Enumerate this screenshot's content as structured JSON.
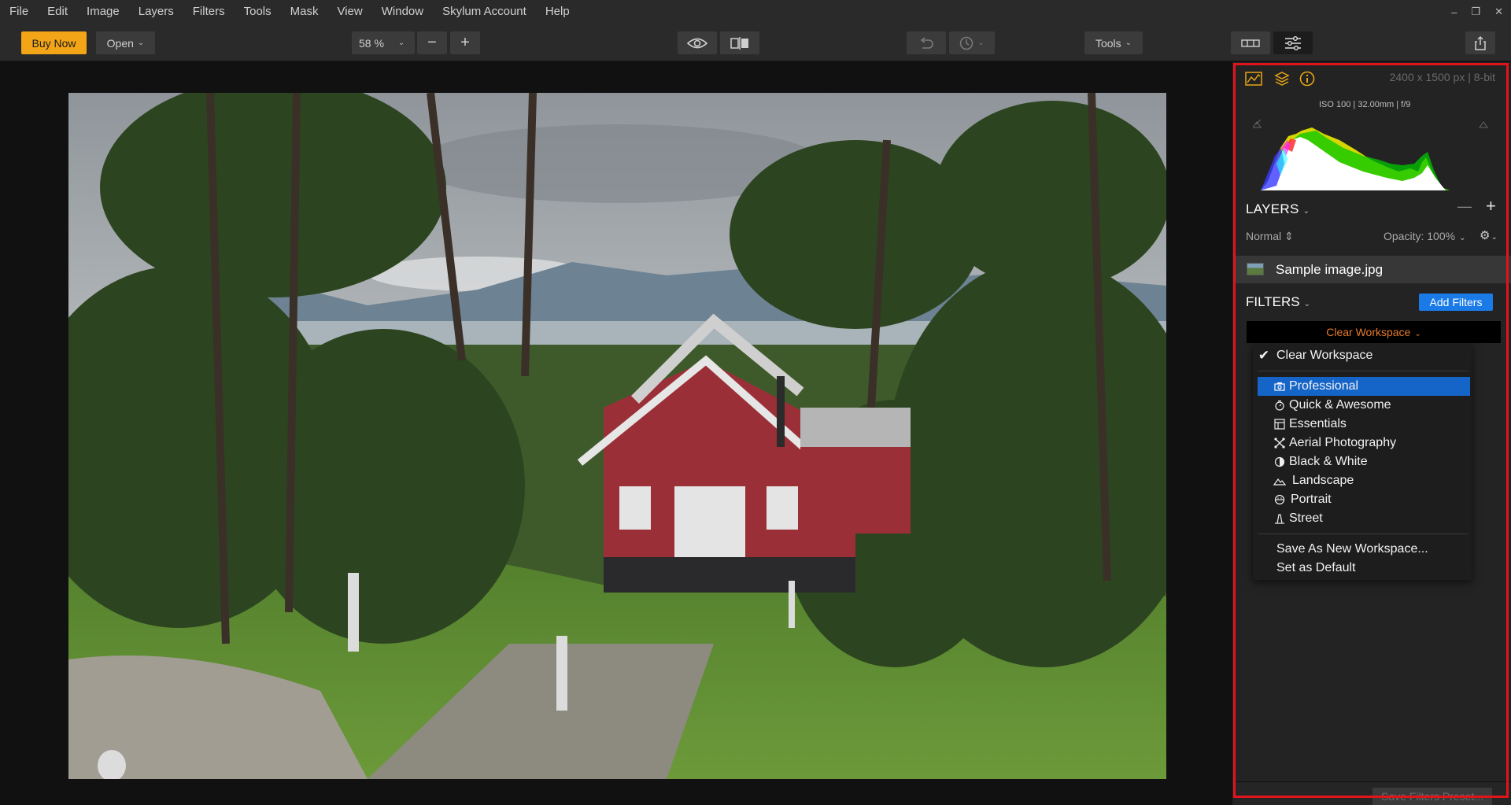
{
  "menu": [
    "File",
    "Edit",
    "Image",
    "Layers",
    "Filters",
    "Tools",
    "Mask",
    "View",
    "Window",
    "Skylum Account",
    "Help"
  ],
  "window_controls": {
    "minimize": "–",
    "restore": "❐",
    "close": "✕"
  },
  "toolbar": {
    "buy_now": "Buy Now",
    "open": "Open",
    "zoom": "58 %",
    "zoom_out": "−",
    "zoom_in": "+",
    "tools": "Tools"
  },
  "panel": {
    "dimensions": "2400 x 1500 px  |  8-bit",
    "exif": "ISO 100  |  32.00mm  |  f/9",
    "layers_title": "LAYERS",
    "blend_mode": "Normal",
    "opacity": "Opacity: 100%",
    "layer_minus": "—",
    "layer_plus": "+",
    "layer_name": "Sample image.jpg",
    "filters_title": "FILTERS",
    "add_filters": "Add Filters",
    "workspace_selected": "Clear Workspace",
    "workspace_menu": {
      "checked": "Clear Workspace",
      "items": [
        {
          "label": "Professional",
          "icon": "camera-icon",
          "highlighted": true
        },
        {
          "label": "Quick & Awesome",
          "icon": "stopwatch-icon"
        },
        {
          "label": "Essentials",
          "icon": "essentials-icon"
        },
        {
          "label": "Aerial Photography",
          "icon": "drone-icon"
        },
        {
          "label": "Black & White",
          "icon": "half-circle-icon"
        },
        {
          "label": "Landscape",
          "icon": "mountain-icon"
        },
        {
          "label": "Portrait",
          "icon": "portrait-icon"
        },
        {
          "label": "Street",
          "icon": "street-icon"
        }
      ],
      "save_as": "Save As New Workspace...",
      "set_default": "Set as Default"
    },
    "save_preset": "Save Filters Preset..."
  },
  "colors": {
    "accent_orange": "#f2a516",
    "accent_blue": "#1a7ae8",
    "highlight": "#1565c8",
    "workspace_text": "#e57a2a",
    "frame_red": "#e2141b"
  }
}
